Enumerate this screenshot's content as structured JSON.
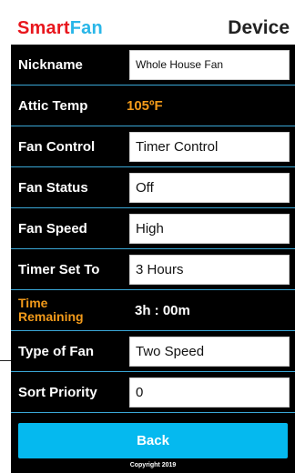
{
  "header": {
    "brand_smart": "Smart",
    "brand_fan": "Fan",
    "title": "Device"
  },
  "rows": [
    {
      "label": "Nickname",
      "value": "Whole House Fan"
    },
    {
      "label": "Attic Temp",
      "value": "105ºF"
    },
    {
      "label": "Fan Control",
      "value": "Timer Control"
    },
    {
      "label": "Fan Status",
      "value": "Off"
    },
    {
      "label": "Fan Speed",
      "value": "High"
    },
    {
      "label": "Timer Set To",
      "value": "3 Hours"
    },
    {
      "label_line1": "Time",
      "label_line2": "Remaining",
      "value": "3h : 00m"
    },
    {
      "label": "Type of Fan",
      "value": "Two Speed"
    },
    {
      "label": "Sort Priority",
      "value": "0"
    }
  ],
  "back_label": "Back",
  "copyright": "Copyright 2019",
  "colors": {
    "background": "#000000",
    "accent_blue": "#29b6e8",
    "button_blue": "#05b9ef",
    "brand_red": "#e8161d",
    "highlight_orange": "#f29a1a",
    "divider": "#3aa7d6"
  }
}
